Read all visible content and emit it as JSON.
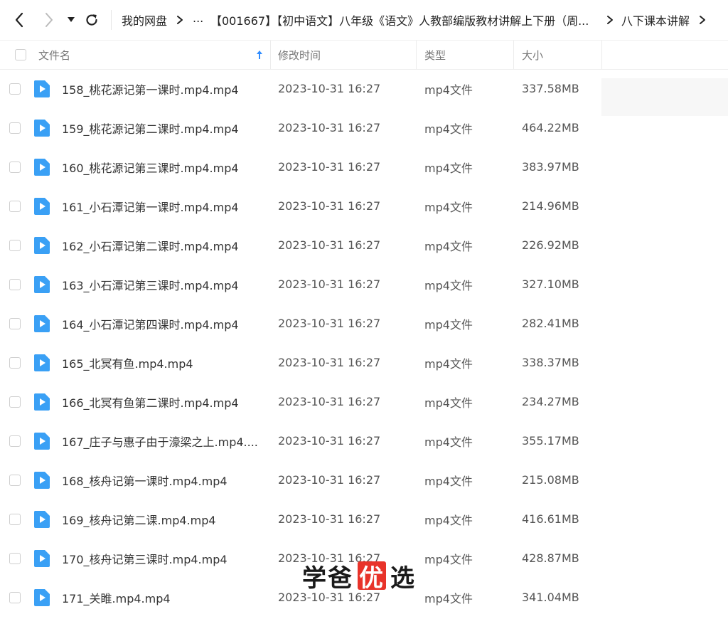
{
  "nav": {
    "crumbs": [
      "我的网盘",
      "...",
      "【001667】【初中语文】八年级《语文》人教部编版教材讲解上下册（周...",
      "八下课本讲解"
    ]
  },
  "table": {
    "headers": {
      "name": "文件名",
      "modified": "修改时间",
      "type": "类型",
      "size": "大小"
    },
    "rows": [
      {
        "name": "158_桃花源记第一课时.mp4.mp4",
        "modified": "2023-10-31 16:27",
        "type": "mp4文件",
        "size": "337.58MB"
      },
      {
        "name": "159_桃花源记第二课时.mp4.mp4",
        "modified": "2023-10-31 16:27",
        "type": "mp4文件",
        "size": "464.22MB"
      },
      {
        "name": "160_桃花源记第三课时.mp4.mp4",
        "modified": "2023-10-31 16:27",
        "type": "mp4文件",
        "size": "383.97MB"
      },
      {
        "name": "161_小石潭记第一课时.mp4.mp4",
        "modified": "2023-10-31 16:27",
        "type": "mp4文件",
        "size": "214.96MB"
      },
      {
        "name": "162_小石潭记第二课时.mp4.mp4",
        "modified": "2023-10-31 16:27",
        "type": "mp4文件",
        "size": "226.92MB"
      },
      {
        "name": "163_小石潭记第三课时.mp4.mp4",
        "modified": "2023-10-31 16:27",
        "type": "mp4文件",
        "size": "327.10MB"
      },
      {
        "name": "164_小石潭记第四课时.mp4.mp4",
        "modified": "2023-10-31 16:27",
        "type": "mp4文件",
        "size": "282.41MB"
      },
      {
        "name": "165_北冥有鱼.mp4.mp4",
        "modified": "2023-10-31 16:27",
        "type": "mp4文件",
        "size": "338.37MB"
      },
      {
        "name": "166_北冥有鱼第二课时.mp4.mp4",
        "modified": "2023-10-31 16:27",
        "type": "mp4文件",
        "size": "234.27MB"
      },
      {
        "name": "167_庄子与惠子由于濠梁之上.mp4....",
        "modified": "2023-10-31 16:27",
        "type": "mp4文件",
        "size": "355.17MB"
      },
      {
        "name": "168_核舟记第一课时.mp4.mp4",
        "modified": "2023-10-31 16:27",
        "type": "mp4文件",
        "size": "215.08MB"
      },
      {
        "name": "169_核舟记第二课.mp4.mp4",
        "modified": "2023-10-31 16:27",
        "type": "mp4文件",
        "size": "416.61MB"
      },
      {
        "name": "170_核舟记第三课时.mp4.mp4",
        "modified": "2023-10-31 16:27",
        "type": "mp4文件",
        "size": "428.87MB"
      },
      {
        "name": "171_关睢.mp4.mp4",
        "modified": "2023-10-31 16:27",
        "type": "mp4文件",
        "size": "341.04MB"
      }
    ]
  },
  "watermark": {
    "part1": "学爸",
    "chip": "优",
    "part2": "选"
  },
  "icons": {
    "back": "chevron-left-icon",
    "forward": "chevron-right-icon",
    "dropdown": "caret-down-icon",
    "refresh": "refresh-icon",
    "breadcrumb_sep": "chevron-right-icon",
    "sort": "arrow-up-icon",
    "file": "video-file-icon"
  },
  "colors": {
    "accent": "#2f8cff",
    "file_icon": "#3aa0f5",
    "watermark_chip": "#e8332a"
  }
}
